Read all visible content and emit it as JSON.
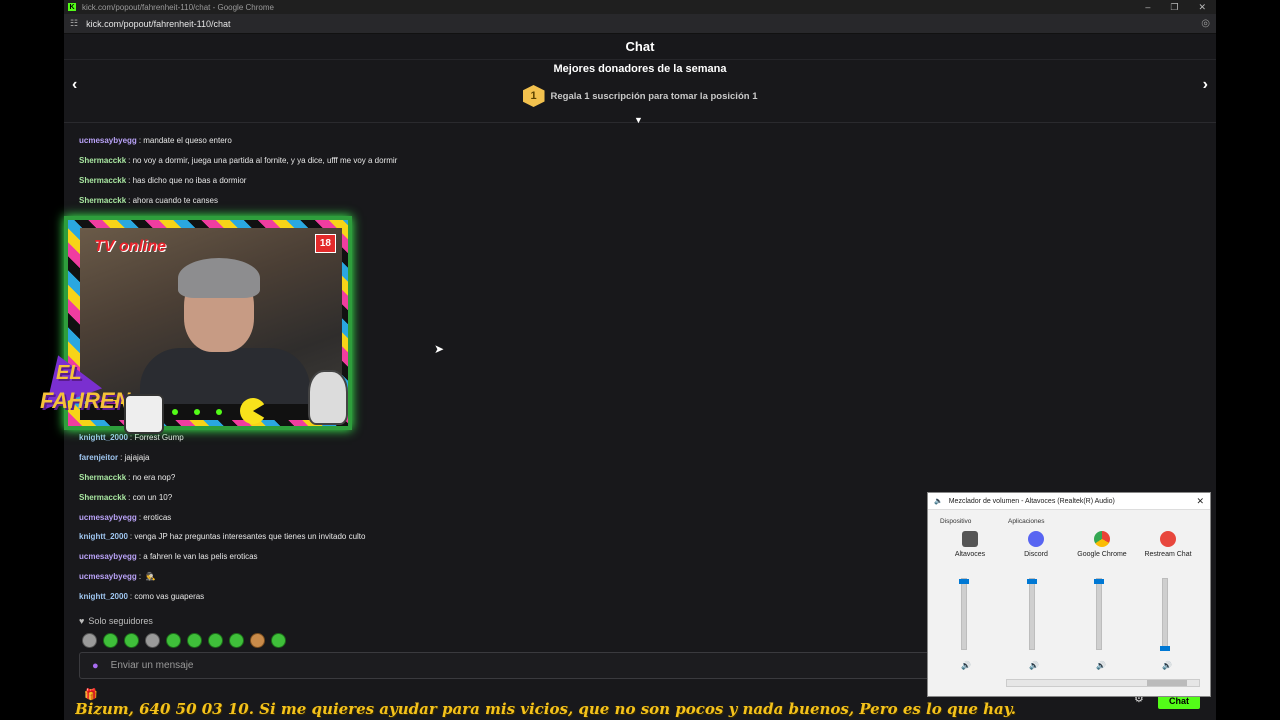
{
  "browser": {
    "window_title": "kick.com/popout/fahrenheit-110/chat - Google Chrome",
    "url": "kick.com/popout/fahrenheit-110/chat",
    "controls": [
      "–",
      "❐",
      "✕"
    ]
  },
  "chat": {
    "title": "Chat",
    "donors_title": "Mejores donadores de la semana",
    "donor_rank": "1",
    "donor_text": "Regala 1 suscripción para tomar la posición 1",
    "messages_top": [
      {
        "user": "ucmesaybyegg",
        "color": "purple",
        "text": "mandate el queso entero"
      },
      {
        "user": "Shermacckk",
        "color": "green",
        "text": "no voy a dormir, juega una partida al fornite, y ya dice, ufff me voy a dormir"
      },
      {
        "user": "Shermacckk",
        "color": "green",
        "text": "has dicho que no ibas a dormior"
      },
      {
        "user": "Shermacckk",
        "color": "green",
        "text": "ahora cuando te canses"
      }
    ],
    "messages_bottom": [
      {
        "user": "knightt_2000",
        "color": "blue",
        "text": "Forrest Gump"
      },
      {
        "user": "farenjeitor",
        "color": "blue",
        "text": "jajajaja"
      },
      {
        "user": "Shermacckk",
        "color": "green",
        "text": "no era nop?"
      },
      {
        "user": "Shermacckk",
        "color": "green",
        "text": "con un 10?"
      },
      {
        "user": "ucmesaybyegg",
        "color": "purple",
        "text": "eroticas"
      },
      {
        "user": "knightt_2000",
        "color": "blue",
        "text": "venga JP haz preguntas interesantes que tienes un invitado culto"
      },
      {
        "user": "ucmesaybyegg",
        "color": "purple",
        "text": "a fahren le van las pelis eroticas"
      },
      {
        "user": "ucmesaybyegg",
        "color": "purple",
        "text": "🕵"
      },
      {
        "user": "knightt_2000",
        "color": "blue",
        "text": "como vas guaperas"
      }
    ],
    "followers_mode": "Solo seguidores",
    "input_placeholder": "Enviar un mensaje",
    "send_label": "Chat"
  },
  "overlay": {
    "tv_label": "TV online",
    "age_badge": "18",
    "brand_line1": "EL",
    "brand_line2": "FAHREN"
  },
  "mixer": {
    "title": "Mezclador de volumen - Altavoces (Realtek(R) Audio)",
    "device_label": "Dispositivo",
    "apps_label": "Aplicaciones",
    "channels": [
      {
        "name": "Altavoces",
        "level": 1.0
      },
      {
        "name": "Discord",
        "level": 1.0
      },
      {
        "name": "Google Chrome",
        "level": 1.0
      },
      {
        "name": "Restream Chat",
        "level": 0.0
      }
    ]
  },
  "ticker": {
    "text": "Bizum, 640 50 03 10.  Si me quieres ayudar para mis vicios, que no son pocos y nada buenos, Pero es lo que hay."
  }
}
